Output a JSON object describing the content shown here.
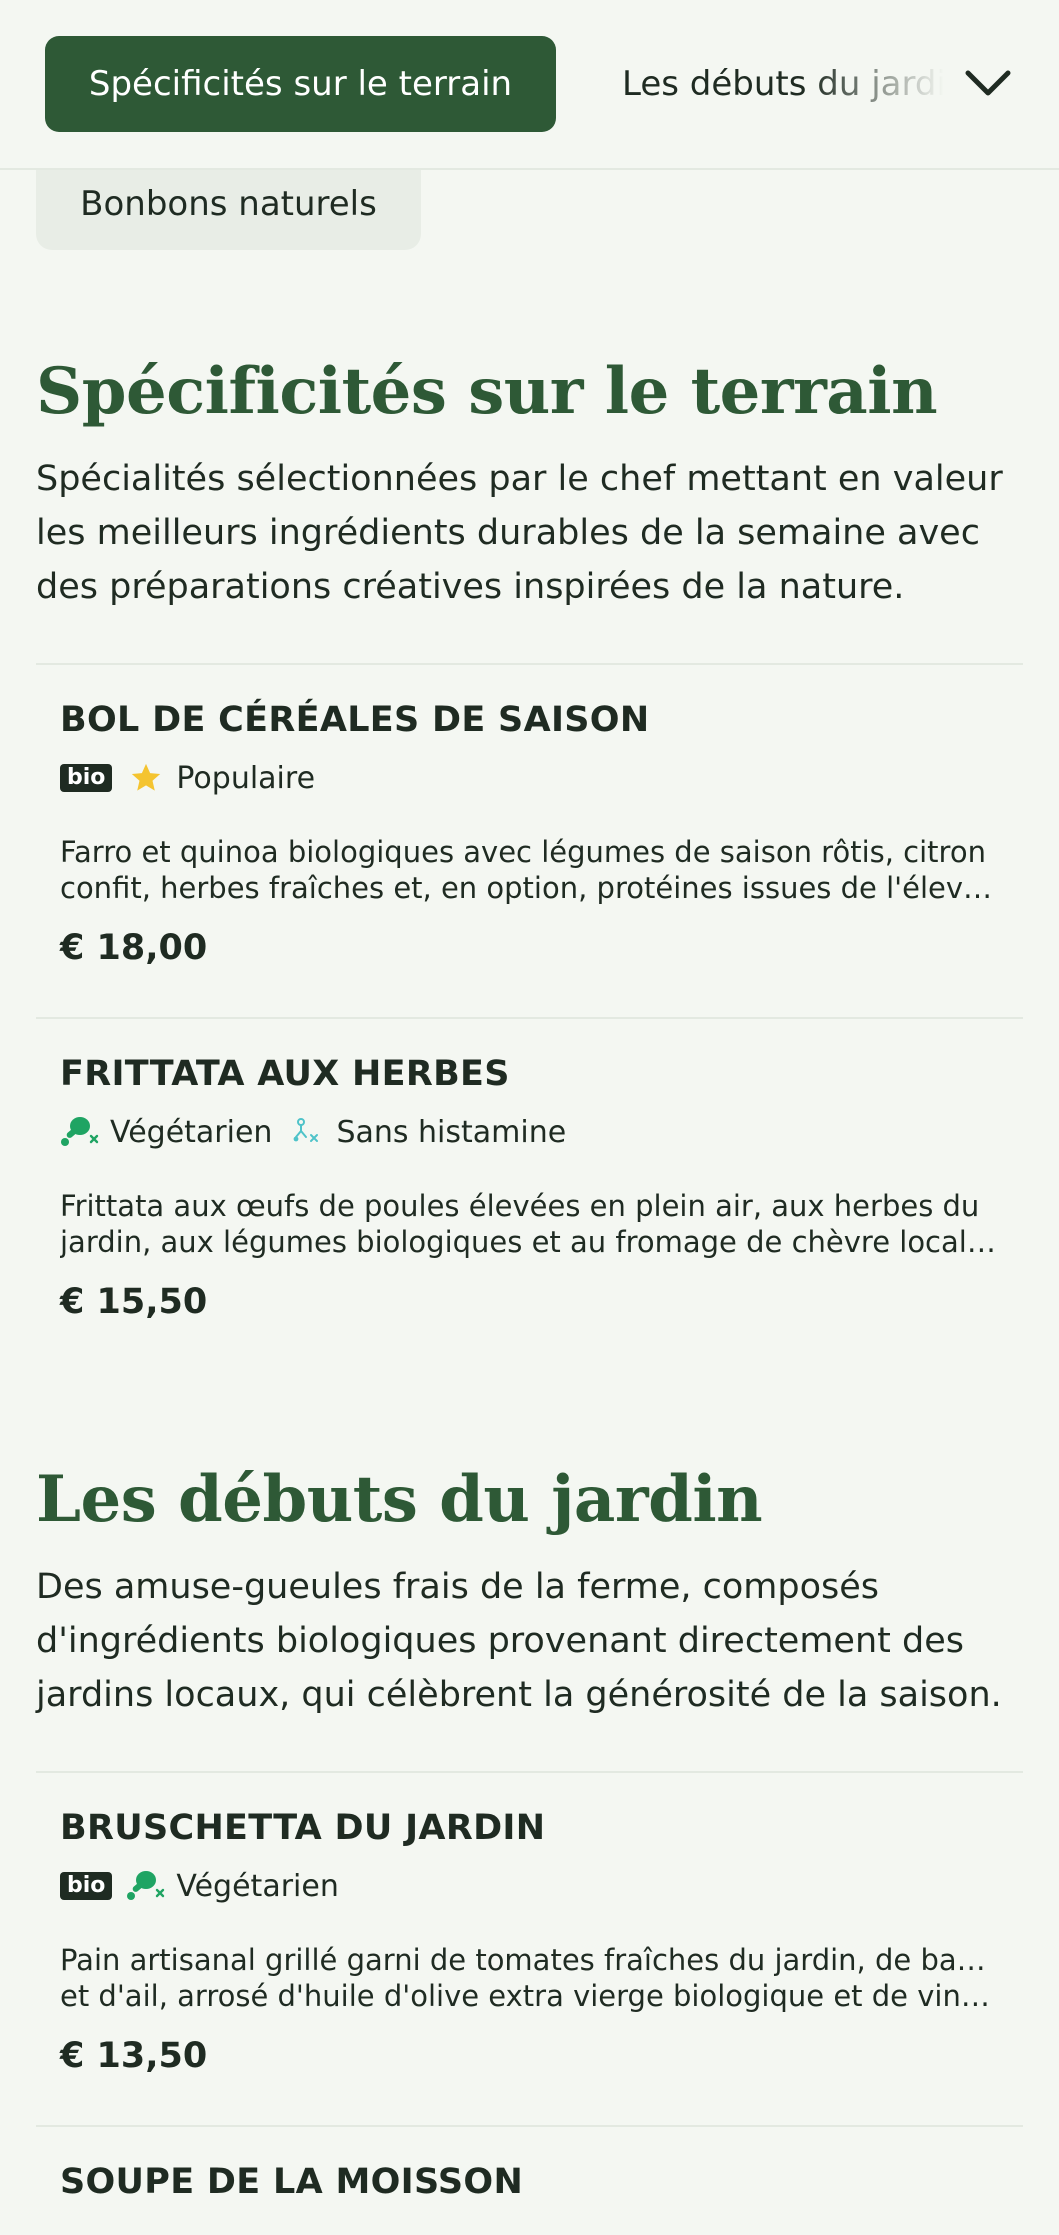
{
  "nav": {
    "active_category": "Spécificités sur le terrain",
    "next_category": "Les débuts du jardin",
    "chip_label": "Bonbons naturels"
  },
  "sections": [
    {
      "title": "Spécificités sur le terrain",
      "description": "Spécialités sélectionnées par le chef mettant en valeur les meilleurs ingrédients durables de la semaine avec des préparations créatives inspirées de la nature.",
      "items": [
        {
          "name": "BOL DE CÉRÉALES DE SAISON",
          "bio": "bio",
          "tags": [
            {
              "icon": "star-icon",
              "label": "Populaire"
            }
          ],
          "desc_line1": "Farro et quinoa biologiques avec légumes de saison rôtis, citron",
          "desc_line2": "confit, herbes fraîches et, en option, protéines issues de l'élevage",
          "price": "€ 18,00"
        },
        {
          "name": "FRITTATA AUX HERBES",
          "bio": "",
          "tags": [
            {
              "icon": "vegetarian-drumstick-icon",
              "label": "Végétarien"
            },
            {
              "icon": "histamine-free-icon",
              "label": "Sans histamine"
            }
          ],
          "desc_line1": "Frittata aux œufs de poules élevées en plein air, aux herbes du",
          "desc_line2": "jardin, aux légumes biologiques et au fromage de chèvre local, servie",
          "price": "€ 15,50"
        }
      ]
    },
    {
      "title": "Les débuts du jardin",
      "description": "Des amuse-gueules frais de la ferme, composés d'ingrédients biologiques provenant directement des jardins locaux, qui célèbrent la générosité de la saison.",
      "items": [
        {
          "name": "BRUSCHETTA DU JARDIN",
          "bio": "bio",
          "tags": [
            {
              "icon": "vegetarian-drumstick-icon",
              "label": "Végétarien"
            }
          ],
          "desc_line1": "Pain artisanal grillé garni de tomates fraîches du jardin, de basilic",
          "desc_line2": "et d'ail, arrosé d'huile d'olive extra vierge biologique et de vinaigre",
          "price": "€ 13,50"
        },
        {
          "name": "SOUPE DE LA MOISSON"
        }
      ]
    }
  ],
  "colors": {
    "brand_green": "#2e5936",
    "background": "#f4f7f2",
    "text": "#1f2b22",
    "veg_icon_green": "#1fa463",
    "histamine_icon": "#4fc3c9",
    "star_yellow": "#f4c430"
  }
}
